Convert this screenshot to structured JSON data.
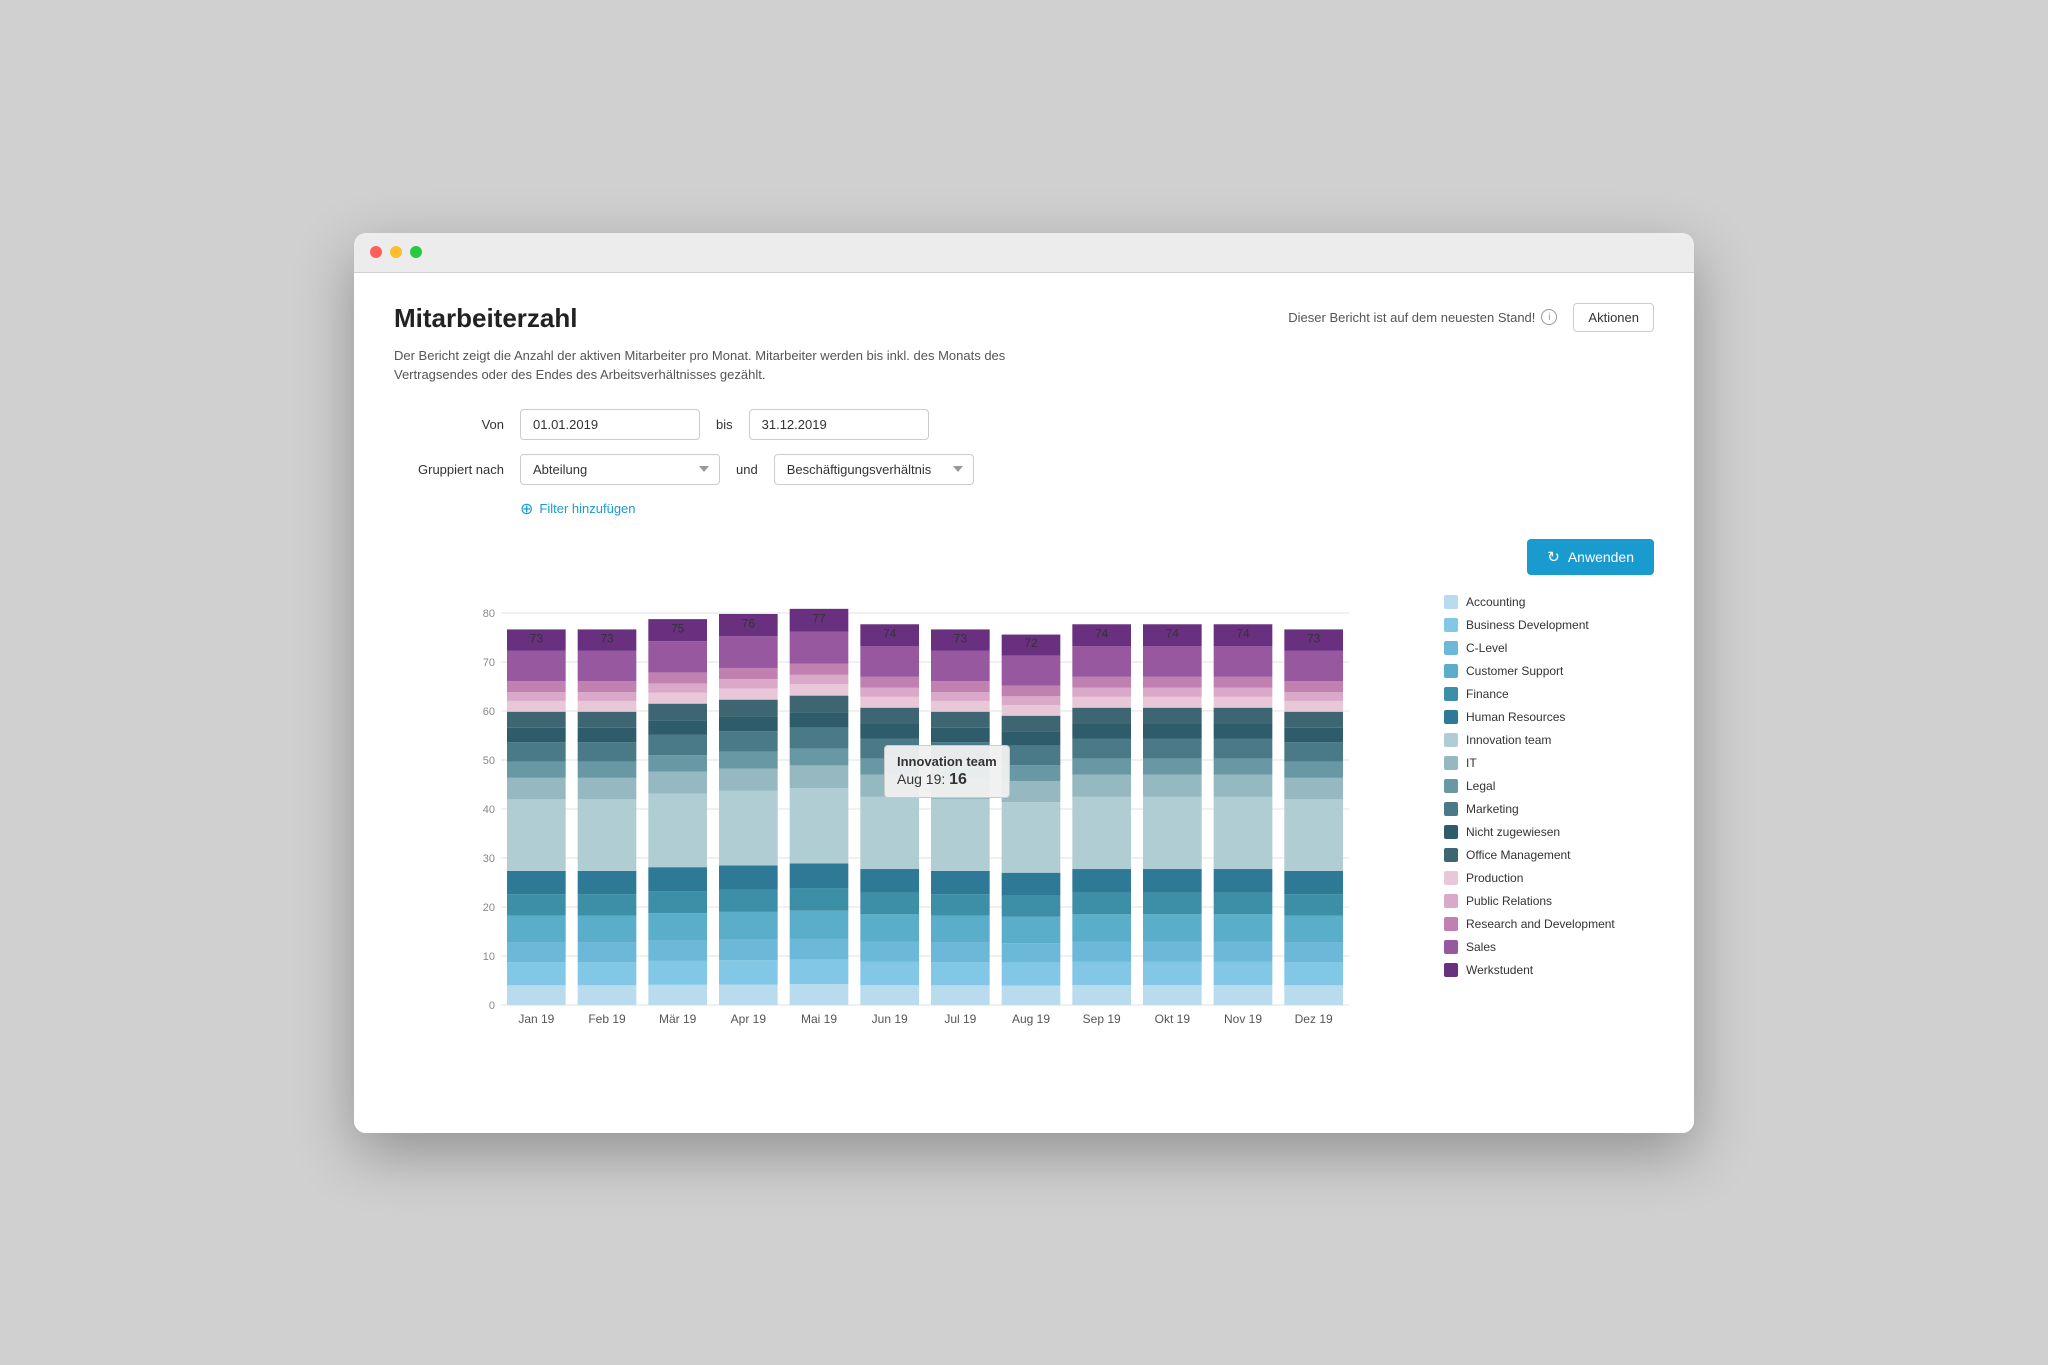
{
  "window": {
    "title": "Mitarbeiterzahl"
  },
  "header": {
    "title": "Mitarbeiterzahl",
    "status": "Dieser Bericht ist auf dem neuesten Stand!",
    "aktionen_label": "Aktionen"
  },
  "description": "Der Bericht zeigt die Anzahl der aktiven Mitarbeiter pro Monat. Mitarbeiter werden bis inkl. des Monats des Vertragsendes oder des Endes des Arbeitsverhältnisses gezählt.",
  "filters": {
    "von_label": "Von",
    "von_value": "01.01.2019",
    "bis_label": "bis",
    "bis_value": "31.12.2019",
    "gruppiert_label": "Gruppiert nach",
    "gruppiert_value": "Abteilung",
    "und_label": "und",
    "beschaeftigung_value": "Beschäftigungsverhältnis",
    "add_filter_label": "Filter hinzufügen",
    "apply_label": "Anwenden"
  },
  "chart": {
    "months": [
      "Jan 19",
      "Feb 19",
      "Mär 19",
      "Apr 19",
      "Mai 19",
      "Jun 19",
      "Jul 19",
      "Aug 19",
      "Sep 19",
      "Okt 19",
      "Nov 19",
      "Dez 19"
    ],
    "totals": [
      73,
      73,
      75,
      76,
      77,
      74,
      73,
      72,
      74,
      74,
      74,
      73
    ],
    "y_max": 80,
    "y_ticks": [
      0,
      10,
      20,
      30,
      40,
      50,
      60,
      70,
      80
    ],
    "tooltip": {
      "title": "Innovation team",
      "month": "Aug 19:",
      "value": "16",
      "visible": true,
      "col_index": 7
    }
  },
  "legend": {
    "items": [
      {
        "label": "Accounting",
        "color": "#b8dced"
      },
      {
        "label": "Business Development",
        "color": "#82c8e6"
      },
      {
        "label": "C-Level",
        "color": "#6bb8d8"
      },
      {
        "label": "Customer Support",
        "color": "#5aaeca"
      },
      {
        "label": "Finance",
        "color": "#3d8fa8"
      },
      {
        "label": "Human Resources",
        "color": "#2e7a96"
      },
      {
        "label": "Innovation team",
        "color": "#b0cdd4"
      },
      {
        "label": "IT",
        "color": "#96b8c0"
      },
      {
        "label": "Legal",
        "color": "#6898a4"
      },
      {
        "label": "Marketing",
        "color": "#4a7a88"
      },
      {
        "label": "Nicht zugewiesen",
        "color": "#2e5c6a"
      },
      {
        "label": "Office Management",
        "color": "#3d6672"
      },
      {
        "label": "Production",
        "color": "#e8c8d8"
      },
      {
        "label": "Public Relations",
        "color": "#daa8c8"
      },
      {
        "label": "Research and Development",
        "color": "#c080b0"
      },
      {
        "label": "Sales",
        "color": "#9858a0"
      },
      {
        "label": "Werkstudent",
        "color": "#6a3080"
      }
    ]
  }
}
